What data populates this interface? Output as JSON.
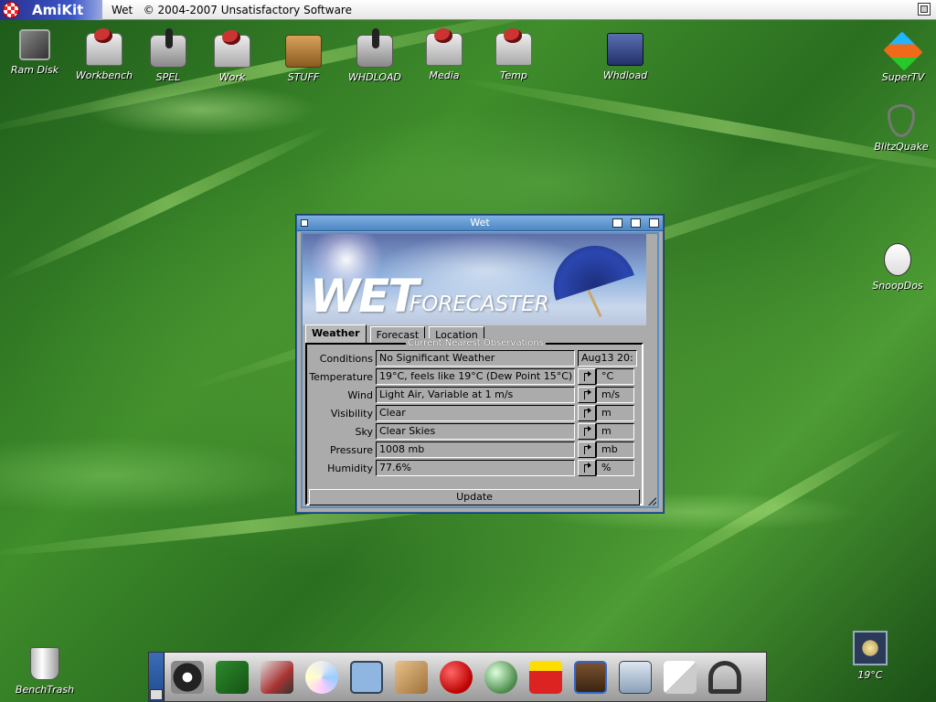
{
  "screen": {
    "logo_text": "AmiKit",
    "title": "Wet   © 2004-2007 Unsatisfactory Software"
  },
  "desktop_icons": [
    {
      "label": "Ram Disk",
      "icon": "ram-chip-icon"
    },
    {
      "label": "Workbench",
      "icon": "harddisk-icon"
    },
    {
      "label": "SPEL",
      "icon": "joystick-icon"
    },
    {
      "label": "Work",
      "icon": "harddisk-icon"
    },
    {
      "label": "STUFF",
      "icon": "package-icon"
    },
    {
      "label": "WHDLOAD",
      "icon": "joystick-icon"
    },
    {
      "label": "Media",
      "icon": "harddisk-icon"
    },
    {
      "label": "Temp",
      "icon": "harddisk-icon"
    },
    {
      "label": "Whdload",
      "icon": "gamepad-icon"
    },
    {
      "label": "SuperTV",
      "icon": "cubes-icon"
    },
    {
      "label": "BlitzQuake",
      "icon": "quake-icon"
    },
    {
      "label": "SnoopDos",
      "icon": "dog-icon"
    },
    {
      "label": "BenchTrash",
      "icon": "trash-icon"
    }
  ],
  "window": {
    "title": "Wet",
    "banner_big": "WET",
    "banner_small": "FORECASTER",
    "tabs": [
      "Weather",
      "Forecast",
      "Location"
    ],
    "active_tab": "Weather",
    "group_title": "Current Nearest Observations",
    "rows": [
      {
        "label": "Conditions",
        "value": "No Significant Weather",
        "extra": "Aug13 20:"
      },
      {
        "label": "Temperature",
        "value": "19°C, feels like 19°C (Dew Point 15°C)",
        "unit": "°C"
      },
      {
        "label": "Wind",
        "value": "Light Air, Variable at 1 m/s",
        "unit": "m/s"
      },
      {
        "label": "Visibility",
        "value": "Clear",
        "unit": "m"
      },
      {
        "label": "Sky",
        "value": "Clear Skies",
        "unit": "m"
      },
      {
        "label": "Pressure",
        "value": "1008 mb",
        "unit": "mb"
      },
      {
        "label": "Humidity",
        "value": "77.6%",
        "unit": "%"
      }
    ],
    "update_label": "Update"
  },
  "dock": {
    "items": [
      "film-reel-icon",
      "notebook-pencil-icon",
      "media-tools-icon",
      "cd-disc-icon",
      "shell-terminal-icon",
      "box-icon",
      "apple-icon",
      "ib-sphere-icon",
      "amp-player-icon",
      "chewbacca-icon",
      "mask-window-icon",
      "notes-paper-icon",
      "headphones-icon"
    ]
  },
  "weather_applet": {
    "temp": "19°C"
  },
  "colors": {
    "title_blue": "#4d86c4",
    "panel_gray": "#ababab",
    "desktop_green": "#3f8d2b"
  }
}
